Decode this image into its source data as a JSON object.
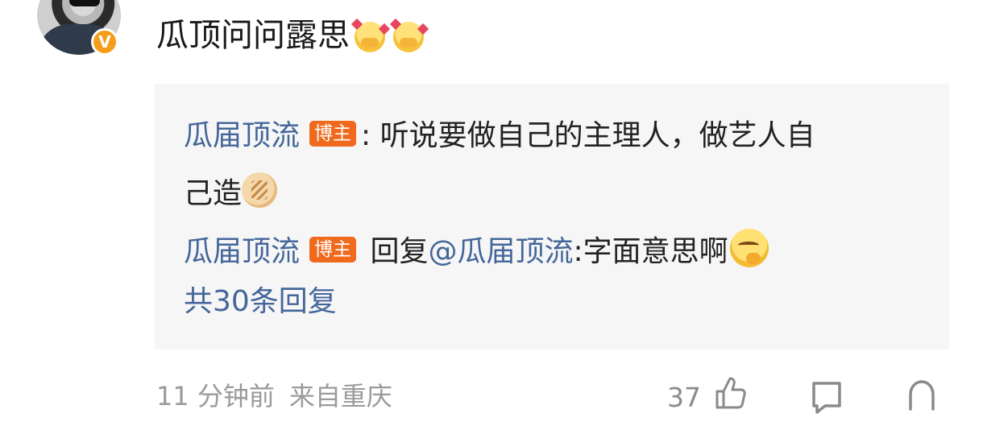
{
  "comment": {
    "text": "瓜顶问问露思",
    "emojis": [
      "heart-hands-emoji",
      "heart-hands-emoji"
    ],
    "verified_badge": "V"
  },
  "replies": [
    {
      "username": "瓜届顶流",
      "badge": "博主",
      "separator": ":",
      "text_line1": " 听说要做自己的主理人，做艺人自",
      "text_line2": "己造",
      "emoji": "bread-emoji"
    },
    {
      "username": "瓜届顶流",
      "badge": "博主",
      "reply_word": "回复",
      "mention": "@瓜届顶流",
      "text": ":字面意思啊",
      "emoji": "thinking-emoji"
    }
  ],
  "total_replies": "共30条回复",
  "footer": {
    "time": "11 分钟前",
    "location": "来自重庆",
    "like_count": "37"
  },
  "colors": {
    "link_blue": "#44669a",
    "badge_orange": "#f06a1e",
    "verified_orange": "#f59d18",
    "reply_bg": "#f6f6f6",
    "meta_gray": "#9a9a9a"
  }
}
